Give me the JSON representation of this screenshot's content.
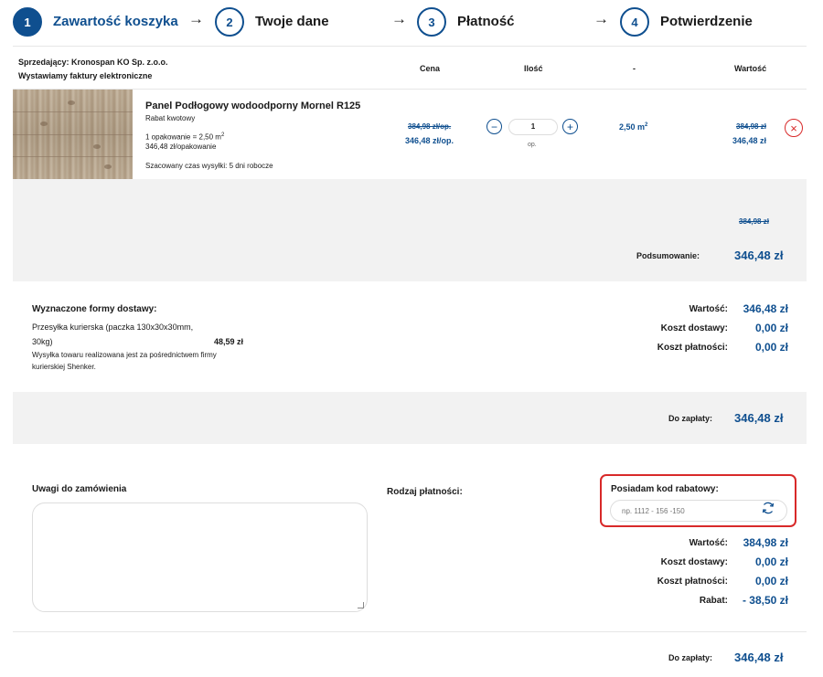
{
  "steps": [
    {
      "num": "1",
      "label": "Zawartość koszyka"
    },
    {
      "num": "2",
      "label": "Twoje dane"
    },
    {
      "num": "3",
      "label": "Płatność"
    },
    {
      "num": "4",
      "label": "Potwierdzenie"
    }
  ],
  "arrow_glyph": "→",
  "seller": {
    "name": "Sprzedający: Kronospan KO Sp. z.o.o.",
    "invoices": "Wystawiamy faktury elektroniczne"
  },
  "columns": {
    "price": "Cena",
    "qty": "Ilość",
    "dash": "-",
    "value": "Wartość"
  },
  "product": {
    "name": "Panel Podłogowy wodoodporny Mornel R125",
    "badge": "Rabat kwotowy",
    "pack_line": "1 opakowanie = 2,50 m",
    "pack_sup": "2",
    "pack_price": "346,48 zł/opakowanie",
    "shipping_time": "Szacowany czas wysyłki: 5 dni robocze",
    "old_price": "384,98 zł/op.",
    "price": "346,48 zł/op.",
    "qty": "1",
    "qty_unit": "op.",
    "minus": "−",
    "plus": "+",
    "area": "2,50 m",
    "area_sup": "2",
    "old_value": "384,98 zł",
    "value": "346,48 zł",
    "remove": "×"
  },
  "summary": {
    "old_total": "384,98 zł",
    "label": "Podsumowanie:",
    "total": "346,48 zł"
  },
  "delivery": {
    "title": "Wyznaczone formy dostawy:",
    "method_line1": "Przesyłka kurierska (paczka 130x30x30mm,",
    "method_line2": "30kg)",
    "method_price": "48,59 zł",
    "note_line1": "Wysyłka towaru realizowana jest za pośrednictwem firmy",
    "note_line2": "kurierskiej Shenker."
  },
  "totals1": [
    {
      "label": "Wartość:",
      "value": "346,48 zł"
    },
    {
      "label": "Koszt dostawy:",
      "value": "0,00 zł"
    },
    {
      "label": "Koszt płatności:",
      "value": "0,00 zł"
    }
  ],
  "pay1": {
    "label": "Do zapłaty:",
    "value": "346,48 zł"
  },
  "notes_label": "Uwagi do zamówienia",
  "payment_label": "Rodzaj płatności:",
  "coupon": {
    "label": "Posiadam kod rabatowy:",
    "placeholder": "np. 1112 - 156 -150"
  },
  "totals2": [
    {
      "label": "Wartość:",
      "value": "384,98 zł"
    },
    {
      "label": "Koszt dostawy:",
      "value": "0,00 zł"
    },
    {
      "label": "Koszt płatności:",
      "value": "0,00 zł"
    },
    {
      "label": "Rabat:",
      "value": "- 38,50 zł"
    }
  ],
  "pay2": {
    "label": "Do zapłaty:",
    "value": "346,48 zł"
  },
  "colors": {
    "accent": "#0f4f8f",
    "danger": "#d82929",
    "panel": "#f2f2f2"
  }
}
